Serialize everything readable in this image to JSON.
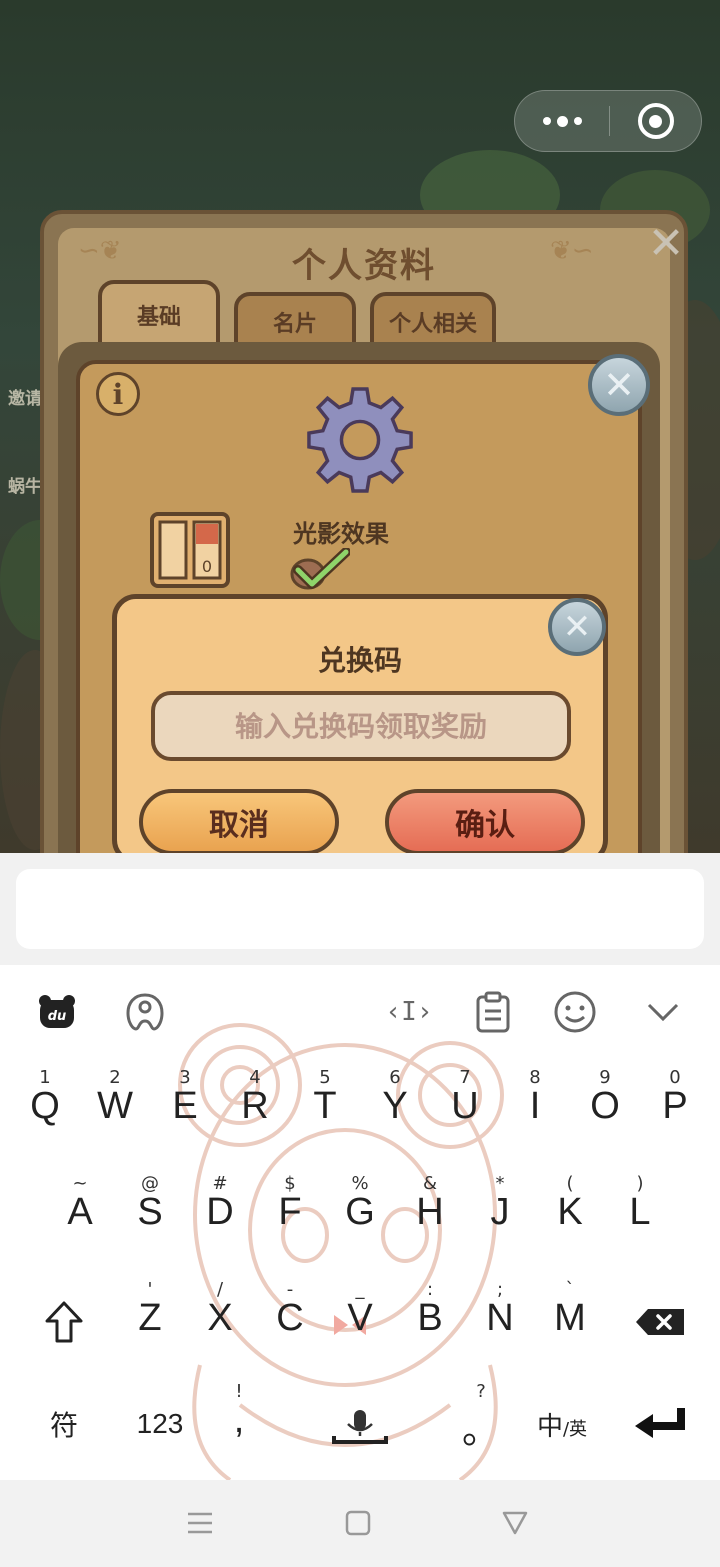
{
  "game": {
    "profile_title": "个人资料",
    "tabs": [
      "基础",
      "名片",
      "个人相关"
    ],
    "side_labels": [
      "邀请",
      "蜗牛"
    ],
    "settings": {
      "info_label": "i",
      "shadow_label": "光影效果",
      "switch_value": "0"
    },
    "redeem": {
      "title": "兑换码",
      "input_placeholder": "输入兑换码领取奖励",
      "cancel_label": "取消",
      "confirm_label": "确认"
    }
  },
  "keyboard": {
    "toolbar_icons": [
      "du-logo-icon",
      "theme-icon",
      "cursor-icon",
      "clipboard-icon",
      "emoji-icon",
      "collapse-chevron-icon"
    ],
    "row1": [
      {
        "main": "Q",
        "sub": "1"
      },
      {
        "main": "W",
        "sub": "2"
      },
      {
        "main": "E",
        "sub": "3"
      },
      {
        "main": "R",
        "sub": "4"
      },
      {
        "main": "T",
        "sub": "5"
      },
      {
        "main": "Y",
        "sub": "6"
      },
      {
        "main": "U",
        "sub": "7"
      },
      {
        "main": "I",
        "sub": "8"
      },
      {
        "main": "O",
        "sub": "9"
      },
      {
        "main": "P",
        "sub": "0"
      }
    ],
    "row2": [
      {
        "main": "A",
        "sub": "~"
      },
      {
        "main": "S",
        "sub": "@"
      },
      {
        "main": "D",
        "sub": "#"
      },
      {
        "main": "F",
        "sub": "$"
      },
      {
        "main": "G",
        "sub": "%"
      },
      {
        "main": "H",
        "sub": "&"
      },
      {
        "main": "J",
        "sub": "*"
      },
      {
        "main": "K",
        "sub": "("
      },
      {
        "main": "L",
        "sub": ")"
      }
    ],
    "row3": [
      {
        "main": "Z",
        "sub": "'"
      },
      {
        "main": "X",
        "sub": "/"
      },
      {
        "main": "C",
        "sub": "-"
      },
      {
        "main": "V",
        "sub": "_"
      },
      {
        "main": "B",
        "sub": ":"
      },
      {
        "main": "N",
        "sub": ";"
      },
      {
        "main": "M",
        "sub": "`"
      }
    ],
    "symbols_label": "符",
    "numbers_label": "123",
    "comma": {
      "main": ",",
      "sub": "!"
    },
    "period": {
      "main": "。",
      "sub": "?"
    },
    "lang_main": "中",
    "lang_sub": "/英"
  }
}
